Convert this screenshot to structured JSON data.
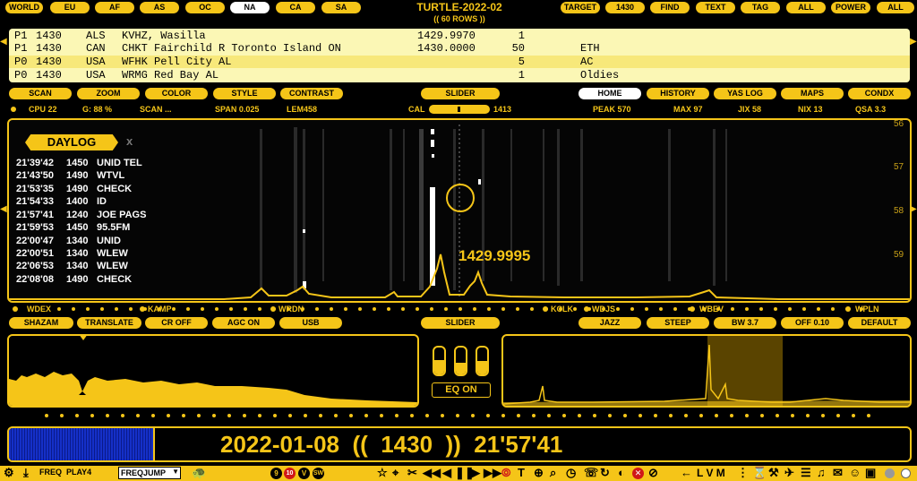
{
  "header": {
    "title": "TURTLE-2022-02",
    "subtitle": "(( 60 ROWS ))",
    "regions": [
      "WORLD",
      "EU",
      "AF",
      "AS",
      "OC",
      "NA",
      "CA",
      "SA"
    ],
    "selected_region": "NA",
    "right_buttons": [
      "TARGET",
      "1430",
      "FIND",
      "TEXT",
      "TAG",
      "ALL",
      "POWER",
      "ALL"
    ]
  },
  "log_table": {
    "rows": [
      {
        "pri": "P1",
        "freq": "1430",
        "country": "ALS",
        "station": "KVHZ, Wasilla",
        "measured": "1429.9970",
        "count": "1",
        "note": ""
      },
      {
        "pri": "P1",
        "freq": "1430",
        "country": "CAN",
        "station": "CHKT Fairchild R Toronto Island ON",
        "measured": "1430.0000",
        "count": "50",
        "note": "ETH"
      },
      {
        "pri": "P0",
        "freq": "1430",
        "country": "USA",
        "station": "WFHK Pell City AL",
        "measured": "",
        "count": "5",
        "note": "AC"
      },
      {
        "pri": "P0",
        "freq": "1430",
        "country": "USA",
        "station": "WRMG Red Bay AL",
        "measured": "",
        "count": "1",
        "note": "Oldies"
      }
    ]
  },
  "toolbar_top": {
    "left": [
      "SCAN",
      "ZOOM",
      "COLOR",
      "STYLE",
      "CONTRAST"
    ],
    "center": "SLIDER",
    "right": [
      "HOME",
      "HISTORY",
      "YAS LOG",
      "MAPS",
      "CONDX"
    ],
    "selected_right": "HOME"
  },
  "status": {
    "cpu": "CPU 22",
    "g": "G: 88 %",
    "scan": "SCAN ...",
    "span": "SPAN 0.025",
    "lem": "LEM458",
    "cal_label": "CAL",
    "cal_value": "1413",
    "cal_level": 0.5,
    "peak": "PEAK 570",
    "max": "MAX 97",
    "jix": "JIX 58",
    "nix": "NIX 13",
    "qsa": "QSA 3.3"
  },
  "daylog": {
    "title": "DAYLOG",
    "close": "x",
    "entries": [
      {
        "time": "21'39'42",
        "freq": "1450",
        "text": "UNID TEL"
      },
      {
        "time": "21'43'50",
        "freq": "1490",
        "text": "WTVL"
      },
      {
        "time": "21'53'35",
        "freq": "1490",
        "text": "CHECK"
      },
      {
        "time": "21'54'33",
        "freq": "1400",
        "text": "ID"
      },
      {
        "time": "21'57'41",
        "freq": "1240",
        "text": "JOE PAGS"
      },
      {
        "time": "21'59'53",
        "freq": "1450",
        "text": "95.5FM"
      },
      {
        "time": "22'00'47",
        "freq": "1340",
        "text": "UNID"
      },
      {
        "time": "22'00'51",
        "freq": "1340",
        "text": "WLEW"
      },
      {
        "time": "22'06'53",
        "freq": "1340",
        "text": "WLEW"
      },
      {
        "time": "22'08'08",
        "freq": "1490",
        "text": "CHECK"
      }
    ]
  },
  "waterfall": {
    "time_ticks": [
      "56",
      "57",
      "58",
      "59"
    ],
    "cursor_freq": "1429.9995"
  },
  "station_markers": [
    "WDEX",
    "KAMP",
    "WRDN",
    "KCLK",
    "WDJS",
    "WBEV",
    "WPLN"
  ],
  "toolbar_mid": {
    "left": [
      "SHAZAM",
      "TRANSLATE",
      "CR OFF",
      "AGC ON",
      "USB"
    ],
    "center": "SLIDER",
    "right": [
      "JAZZ",
      "STEEP",
      "BW 3.7",
      "OFF 0.10",
      "DEFAULT"
    ]
  },
  "eq": {
    "label": "EQ ON",
    "levels": [
      0.55,
      0.45,
      0.5
    ]
  },
  "bottom": {
    "readout": "2022-01-08  ((  1430  ))  21'57'41",
    "level": 0.16
  },
  "bottom_bar": {
    "freq_label": "FREQ",
    "play_label": "PLAY4",
    "freqjump": "FREQJUMP",
    "circles": [
      "9",
      "10",
      "V",
      "SW"
    ],
    "letters": "L V M"
  },
  "colors": {
    "accent": "#f5c518",
    "table_bg": "#fbf7b5",
    "level_blue": "#1530c8"
  }
}
